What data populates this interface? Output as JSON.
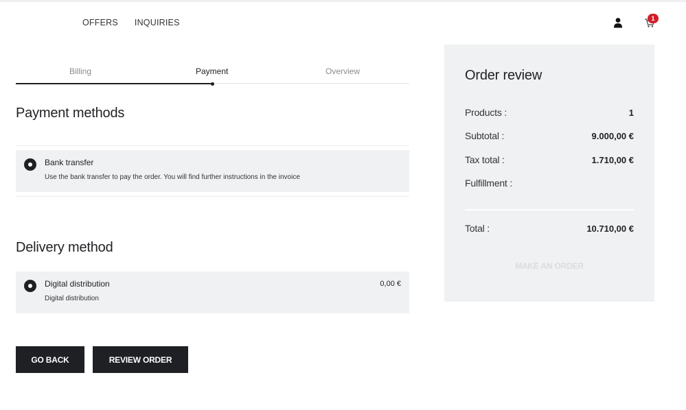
{
  "nav": {
    "items": [
      "OFFERS",
      "INQUIRIES"
    ]
  },
  "header": {
    "cart_count": "1",
    "icons": [
      "user-icon",
      "cart-icon"
    ]
  },
  "steps": {
    "items": [
      "Billing",
      "Payment",
      "Overview"
    ],
    "active": "Payment"
  },
  "payment": {
    "title": "Payment methods",
    "option": {
      "title": "Bank transfer",
      "description": "Use the bank transfer to pay the order. You will find further instructions in the invoice"
    }
  },
  "delivery": {
    "title": "Delivery method",
    "option": {
      "title": "Digital distribution",
      "description": "Digital distribution",
      "price": "0,00 €"
    }
  },
  "actions": {
    "back": "GO BACK",
    "review": "REVIEW ORDER"
  },
  "order_review": {
    "title": "Order review",
    "rows": [
      {
        "label": "Products :",
        "value": "1"
      },
      {
        "label": "Subtotal :",
        "value": "9.000,00 €"
      },
      {
        "label": "Tax total :",
        "value": "1.710,00 €"
      },
      {
        "label": "Fulfillment :",
        "value": ""
      }
    ],
    "total_label": "Total :",
    "total_value": "10.710,00 €",
    "order_button": "MAKE AN ORDER"
  },
  "colors": {
    "accent": "#1f2024",
    "badge": "#d11f2a",
    "panel": "#f0f1f2"
  }
}
